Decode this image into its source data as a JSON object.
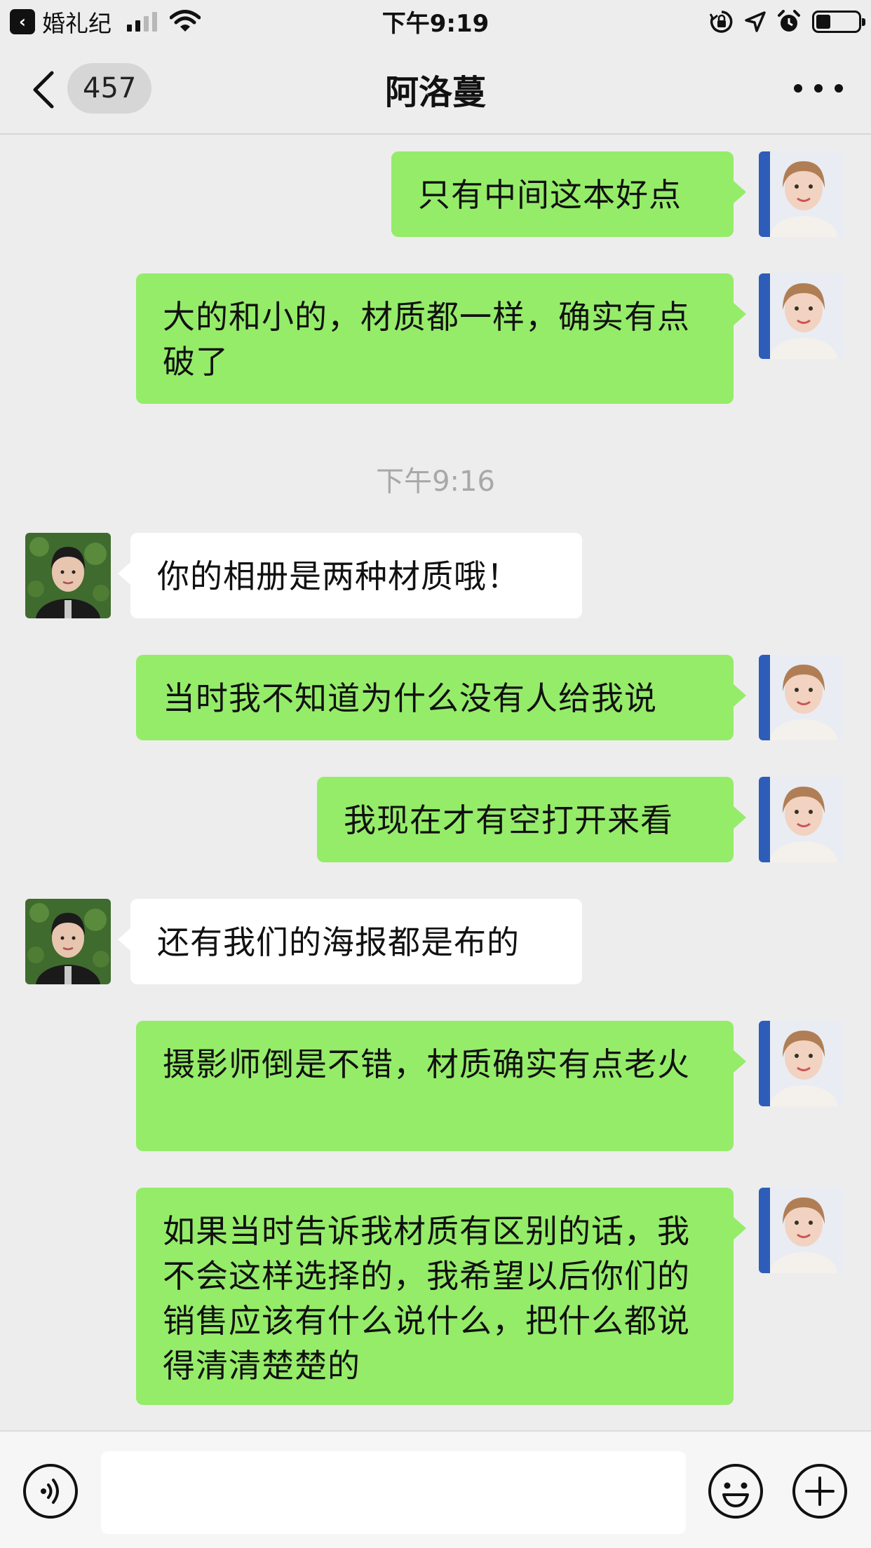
{
  "status_bar": {
    "back_app_label": "婚礼纪",
    "time": "下午9:19",
    "signal_bars_active": 2,
    "battery_level_fraction": 0.34,
    "icons": [
      "signal-icon",
      "wifi-icon",
      "rotation-lock-icon",
      "location-icon",
      "alarm-icon",
      "battery-icon"
    ]
  },
  "nav": {
    "unread_count": "457",
    "title": "阿洛蔓"
  },
  "messages": [
    {
      "side": "out",
      "text": "只有中间这本好点"
    },
    {
      "side": "out",
      "text": "大的和小的，材质都一样，确实有点破了"
    },
    {
      "type": "timestamp",
      "text": "下午9:16"
    },
    {
      "side": "in",
      "text": "你的相册是两种材质哦！"
    },
    {
      "side": "out",
      "text": "当时我不知道为什么没有人给我说"
    },
    {
      "side": "out",
      "text": "我现在才有空打开来看"
    },
    {
      "side": "in",
      "text": "还有我们的海报都是布的"
    },
    {
      "side": "out",
      "text": "摄影师倒是不错，材质确实有点老火"
    },
    {
      "side": "out",
      "text": "如果当时告诉我材质有区别的话，我不会这样选择的，我希望以后你们的销售应该有什么说什么，把什么都说得清清楚楚的"
    }
  ],
  "input_bar": {
    "message_input_value": "",
    "icons": [
      "voice-icon",
      "emoji-icon",
      "plus-icon"
    ]
  },
  "colors": {
    "background": "#ededed",
    "outgoing_bubble": "#95ec69",
    "incoming_bubble": "#ffffff",
    "timestamp_text": "#a8a8a8"
  }
}
